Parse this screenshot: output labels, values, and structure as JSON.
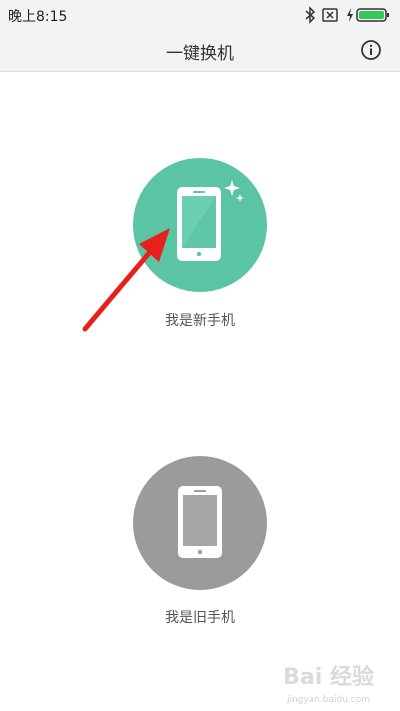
{
  "status_bar": {
    "time": "晚上8:15",
    "icons": [
      "bluetooth-icon",
      "sim-card-icon",
      "charging-bolt-icon",
      "battery-icon"
    ],
    "battery_color": "#34c759"
  },
  "header": {
    "title": "一键换机",
    "info_icon": "info-icon"
  },
  "options": {
    "new_phone": {
      "label": "我是新手机",
      "color": "#5bc4a4",
      "icon": "phone-sparkle-icon"
    },
    "old_phone": {
      "label": "我是旧手机",
      "color": "#9b9b9b",
      "icon": "phone-icon"
    }
  },
  "annotation": {
    "arrow_color": "#e8201c"
  },
  "watermark": {
    "brand": "Bai 经验",
    "url": "jingyan.baidu.com"
  }
}
